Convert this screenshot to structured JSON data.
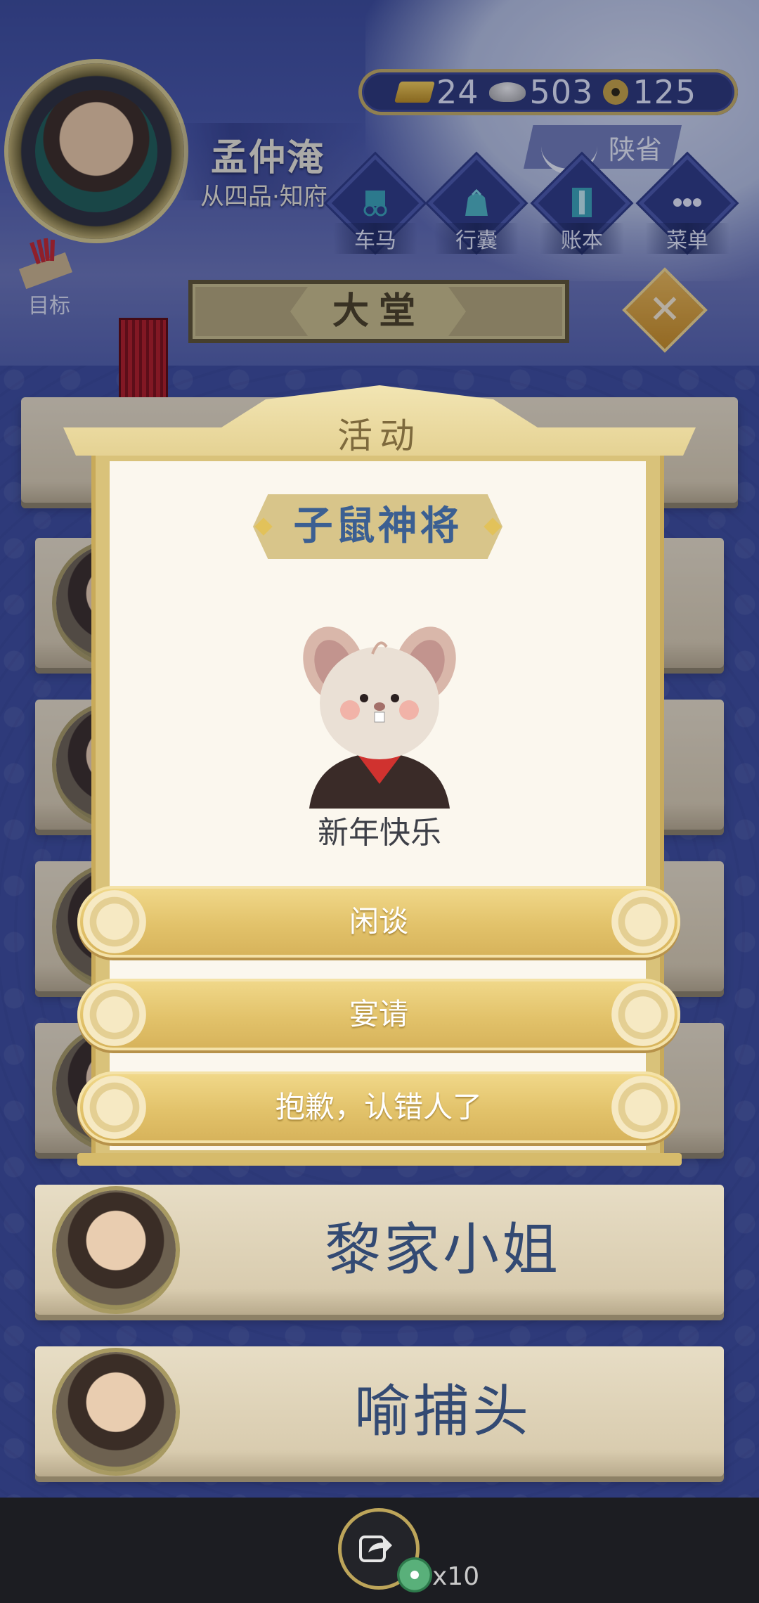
{
  "player": {
    "name": "孟仲淹",
    "rank": "从四品·知府"
  },
  "currency": {
    "gold": "24",
    "silver": "503",
    "coin": "125"
  },
  "location": {
    "name": "陕省"
  },
  "nav": {
    "items": [
      {
        "label": "车马",
        "icon": "carriage-icon"
      },
      {
        "label": "行囊",
        "icon": "bag-icon"
      },
      {
        "label": "账本",
        "icon": "ledger-icon"
      },
      {
        "label": "菜单",
        "icon": "menu-dots-icon"
      }
    ]
  },
  "goal": {
    "label": "目标"
  },
  "hall": {
    "title": "大堂"
  },
  "modal": {
    "title": "活动",
    "npc_name": "子鼠神将",
    "greeting": "新年快乐",
    "options": [
      {
        "label": "闲谈"
      },
      {
        "label": "宴请"
      },
      {
        "label": "抱歉，认错人了"
      }
    ]
  },
  "list": {
    "items": [
      {
        "name": "黎家小姐"
      },
      {
        "name": "喻捕头"
      }
    ]
  },
  "share": {
    "count": "x10"
  },
  "colors": {
    "accent_gold": "#e2c26a",
    "title_blue": "#3b5f92",
    "background_blue": "#3c4c9a"
  }
}
